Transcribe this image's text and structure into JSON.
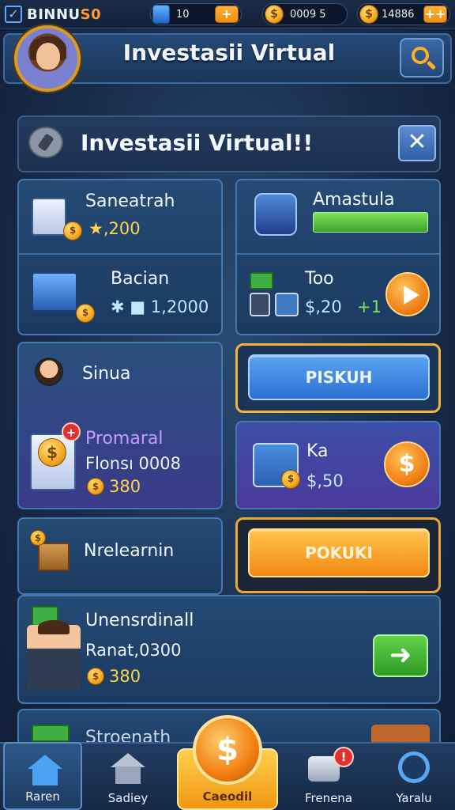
{
  "topbar": {
    "brand_prefix": "BINNU",
    "brand_suffix": "S0",
    "resource1_value": "10",
    "resource1_plus": "+",
    "resource2_value": "0009 5",
    "resource3_value": "14886",
    "resource3_plus": "++"
  },
  "header": {
    "title": "Investasii Virtual"
  },
  "panel": {
    "title": "Investasii Virtual!!",
    "close_label": "✕"
  },
  "cards": {
    "saneatrah": {
      "title": "Saneatrah",
      "value": "★,200"
    },
    "amastula": {
      "title": "Amastula"
    },
    "bacian": {
      "title": "Bacian",
      "value": "✱ ■ 1,2000"
    },
    "too": {
      "title": "Too",
      "value": "$,20",
      "delta": "+1"
    },
    "sinua": {
      "title": "Sinua"
    },
    "piskuh": {
      "label": "PISKUH"
    },
    "promanal": {
      "title": "Promaral",
      "subtitle": "Flonsı 0008",
      "value": "380"
    },
    "ka": {
      "title": "Ka",
      "value": "$,50"
    },
    "nrelearnin": {
      "title": "Nrelearnin"
    },
    "pokuki": {
      "label": "POKUKI"
    },
    "unensrdinall": {
      "title": "Unensrdinall",
      "subtitle": "Ranat,0300",
      "value": "380",
      "arrow": "➜"
    },
    "partial": {
      "title": "Stroenath"
    }
  },
  "nav": {
    "items": [
      {
        "label": "Raren"
      },
      {
        "label": "Sadiey"
      },
      {
        "label": "Caeodil"
      },
      {
        "label": "Frenena"
      },
      {
        "label": "Yaralu"
      }
    ],
    "center_symbol": "$",
    "badge": "!"
  }
}
